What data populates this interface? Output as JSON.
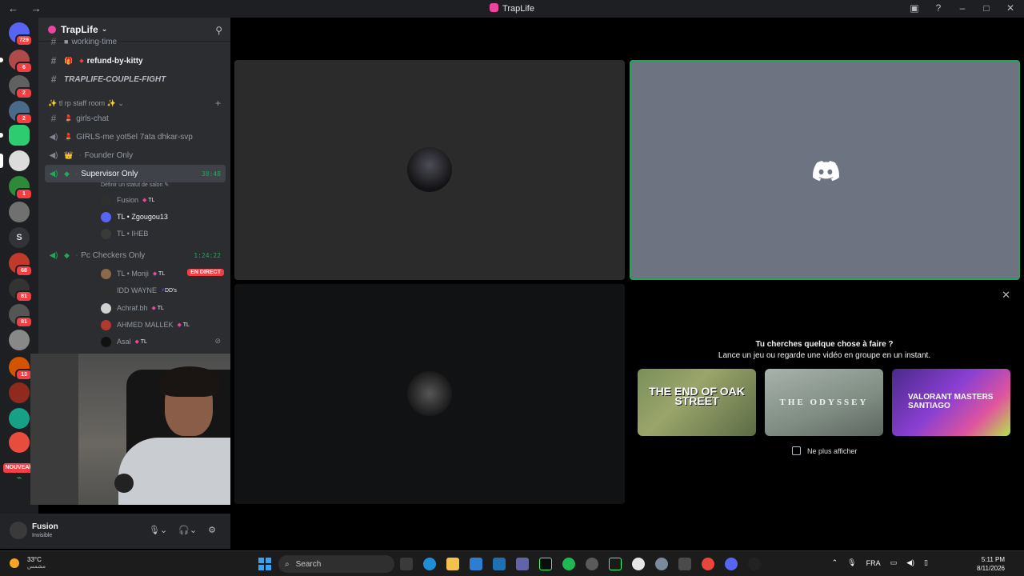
{
  "window": {
    "title": "TrapLife"
  },
  "rail": {
    "badges": [
      "729",
      "6",
      "2",
      "2",
      "1",
      "68",
      "81",
      "81",
      "13"
    ],
    "letter_server": "S",
    "new_label": "NOUVEAU"
  },
  "guild": {
    "name": "TrapLife"
  },
  "channels": {
    "working_time": "working-time",
    "refund": "refund-by-kitty",
    "couple_fight": "TRAPLIFE-COUPLE-FIGHT",
    "category": "tl rp staff room",
    "girls_chat": "girls-chat",
    "girls_me": "GIRLS-me yot5el 7ata dhkar-svp",
    "founder": "Founder Only",
    "supervisor": "Supervisor Only",
    "supervisor_timer": "38:48",
    "status_placeholder": "Définir un statut de salon",
    "pc_checkers": "Pc Checkers Only",
    "pc_timer": "1:24:22"
  },
  "members_supervisor": [
    {
      "name": "Fusion",
      "tag": "TL"
    },
    {
      "name": "TL • Zgougou13",
      "tag": ""
    },
    {
      "name": "TL • IHEB",
      "tag": ""
    }
  ],
  "members_pc": [
    {
      "name": "TL • Monji",
      "tag": "TL",
      "live": "EN DIRECT"
    },
    {
      "name": "IDD WAYNE",
      "tag": "DD's"
    },
    {
      "name": "Achraf.bh",
      "tag": "TL"
    },
    {
      "name": "AHMED MALLEK",
      "tag": "TL"
    },
    {
      "name": "Asal",
      "tag": "TL"
    }
  ],
  "user": {
    "name": "Fusion",
    "status": "Invisible"
  },
  "activity": {
    "heading": "Tu cherches quelque chose à faire ?",
    "subheading": "Lance un jeu ou regarde une vidéo en groupe en un instant.",
    "games": [
      {
        "name": "THE END OF OAK STREET"
      },
      {
        "name": "THE ODYSSEY"
      },
      {
        "name": "VALORANT MASTERS SANTIAGO"
      }
    ],
    "dont_show": "Ne plus afficher"
  },
  "taskbar": {
    "temp": "33°C",
    "weather_desc": "مشمس",
    "search_placeholder": "Search",
    "lang": "FRA",
    "time": "5:11 PM",
    "date": "8/11/2026"
  },
  "colors": {
    "accent": "#5865f2",
    "speaking": "#23a55a",
    "live": "#f23f43"
  }
}
